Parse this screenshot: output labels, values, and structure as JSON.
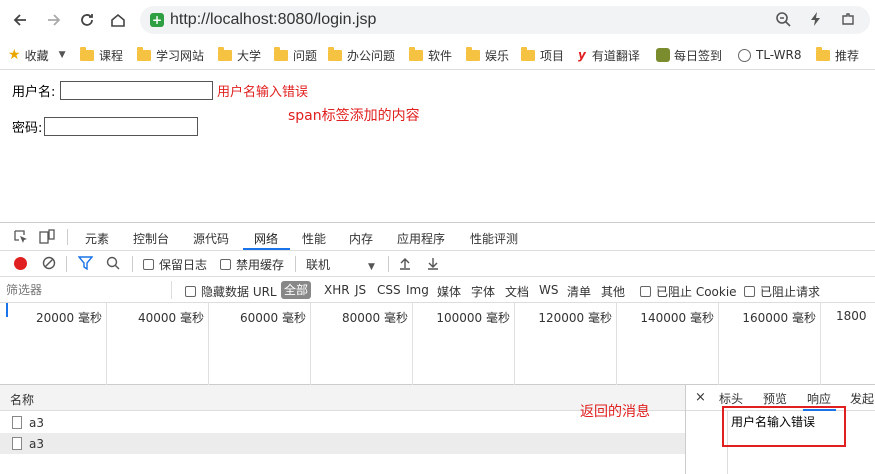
{
  "browser": {
    "url": "http://localhost:8080/login.jsp"
  },
  "bookmarks": {
    "items": [
      {
        "label": "收藏",
        "icon": "star-icon"
      },
      {
        "label": "课程",
        "icon": "folder-icon"
      },
      {
        "label": "学习网站",
        "icon": "folder-icon"
      },
      {
        "label": "大学",
        "icon": "folder-icon"
      },
      {
        "label": "问题",
        "icon": "folder-icon"
      },
      {
        "label": "办公问题",
        "icon": "folder-icon"
      },
      {
        "label": "软件",
        "icon": "folder-icon"
      },
      {
        "label": "娱乐",
        "icon": "folder-icon"
      },
      {
        "label": "项目",
        "icon": "folder-icon"
      },
      {
        "label": "有道翻译",
        "icon": "youdao-icon"
      },
      {
        "label": "每日签到",
        "icon": "signin-icon"
      },
      {
        "label": "TL-WR8",
        "icon": "globe-icon"
      },
      {
        "label": "推荐",
        "icon": "folder-icon"
      }
    ]
  },
  "page": {
    "username_label": "用户名:",
    "username_error": "用户名输入错误",
    "annotation_span": "span标签添加的内容",
    "password_label": "密码:"
  },
  "devtools": {
    "tabs": [
      "元素",
      "控制台",
      "源代码",
      "网络",
      "性能",
      "内存",
      "应用程序",
      "性能评测"
    ],
    "active_tab": "网络",
    "toolbar": {
      "preserve_log": "保留日志",
      "disable_cache": "禁用缓存",
      "throttle": "联机"
    },
    "filter": {
      "placeholder": "筛选器",
      "hide_data_url": "隐藏数据 URL",
      "all": "全部",
      "types": [
        "XHR",
        "JS",
        "CSS",
        "Img",
        "媒体",
        "字体",
        "文档",
        "WS",
        "清单",
        "其他"
      ],
      "blocked_cookies": "已阻止 Cookie",
      "blocked_requests": "已阻止请求"
    },
    "timeline_ticks": [
      "20000 毫秒",
      "40000 毫秒",
      "60000 毫秒",
      "80000 毫秒",
      "100000 毫秒",
      "120000 毫秒",
      "140000 毫秒",
      "160000 毫秒",
      "1800"
    ],
    "requests": {
      "header": "名称",
      "rows": [
        "a3",
        "a3"
      ]
    },
    "annotation_return": "返回的消息",
    "response": {
      "tabs": [
        "标头",
        "预览",
        "响应",
        "发起"
      ],
      "active_tab": "响应",
      "body": "用户名输入错误"
    }
  },
  "colors": {
    "error_red": "#e02020",
    "accent_blue": "#1a73e8",
    "secure_green": "#2ea043"
  }
}
